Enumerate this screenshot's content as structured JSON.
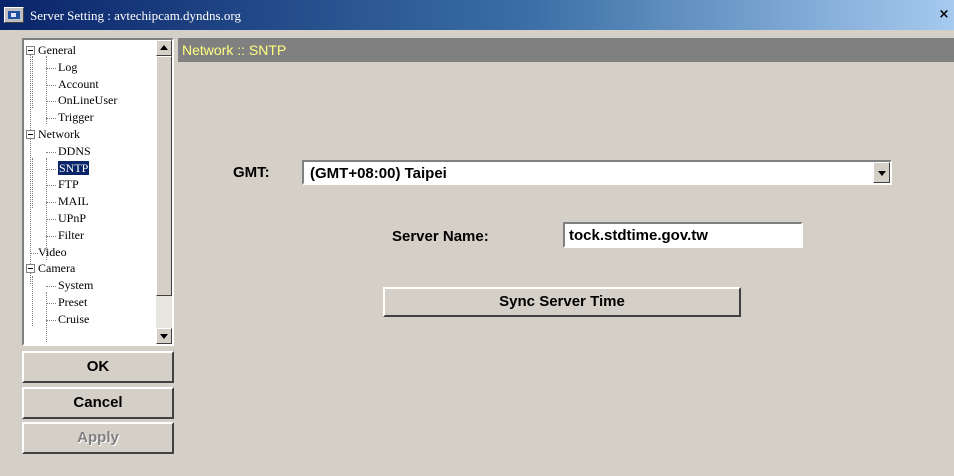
{
  "window": {
    "title": "Server Setting : avtechipcam.dyndns.org",
    "close_label": "×"
  },
  "tree": {
    "groups": [
      {
        "label": "General",
        "children": [
          "Log",
          "Account",
          "OnLineUser",
          "Trigger"
        ]
      },
      {
        "label": "Network",
        "children": [
          "DDNS",
          "SNTP",
          "FTP",
          "MAIL",
          "UPnP",
          "Filter"
        ]
      },
      {
        "label": "Video",
        "children": []
      },
      {
        "label": "Camera",
        "children": [
          "System",
          "Preset",
          "Cruise"
        ]
      }
    ],
    "selected": "SNTP"
  },
  "buttons": {
    "ok": "OK",
    "cancel": "Cancel",
    "apply": "Apply"
  },
  "header": {
    "title": "Network :: SNTP"
  },
  "form": {
    "gmt_label": "GMT:",
    "gmt_value": "(GMT+08:00) Taipei",
    "server_name_label": "Server Name:",
    "server_name_value": "tock.stdtime.gov.tw",
    "sync_button": "Sync Server Time"
  },
  "colors": {
    "header_text": "#ffff80",
    "header_bg": "#808080",
    "selection": "#0a246a"
  }
}
